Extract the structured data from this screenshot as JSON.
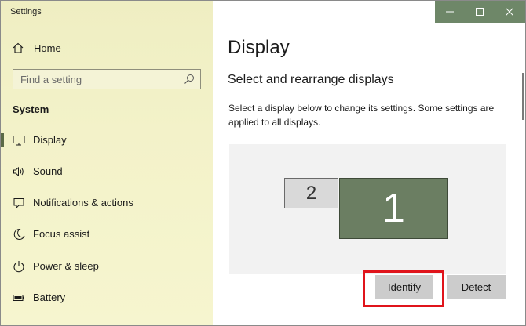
{
  "window": {
    "title": "Settings",
    "controls": {
      "minimize": "–",
      "maximize": "☐",
      "close": "✕"
    }
  },
  "sidebar": {
    "home": {
      "label": "Home",
      "icon": "home-icon"
    },
    "search": {
      "placeholder": "Find a setting",
      "icon": "search-icon"
    },
    "section": "System",
    "items": [
      {
        "label": "Display",
        "icon": "display-icon",
        "active": true
      },
      {
        "label": "Sound",
        "icon": "speaker-icon",
        "active": false
      },
      {
        "label": "Notifications & actions",
        "icon": "notification-icon",
        "active": false
      },
      {
        "label": "Focus assist",
        "icon": "moon-icon",
        "active": false
      },
      {
        "label": "Power & sleep",
        "icon": "power-icon",
        "active": false
      },
      {
        "label": "Battery",
        "icon": "battery-icon",
        "active": false
      }
    ]
  },
  "main": {
    "title": "Display",
    "subheading": "Select and rearrange displays",
    "description": "Select a display below to change its settings. Some settings are applied to all displays.",
    "monitors": [
      {
        "number": "2",
        "selected": false
      },
      {
        "number": "1",
        "selected": true
      }
    ],
    "buttons": {
      "identify": "Identify",
      "detect": "Detect"
    }
  },
  "colors": {
    "sidebar_bg": "#f1f0c6",
    "titlebar_bg": "#6e8768",
    "monitor_selected": "#6b7e62",
    "monitor_unselected": "#d9d9d9",
    "highlight": "#e0141b"
  }
}
